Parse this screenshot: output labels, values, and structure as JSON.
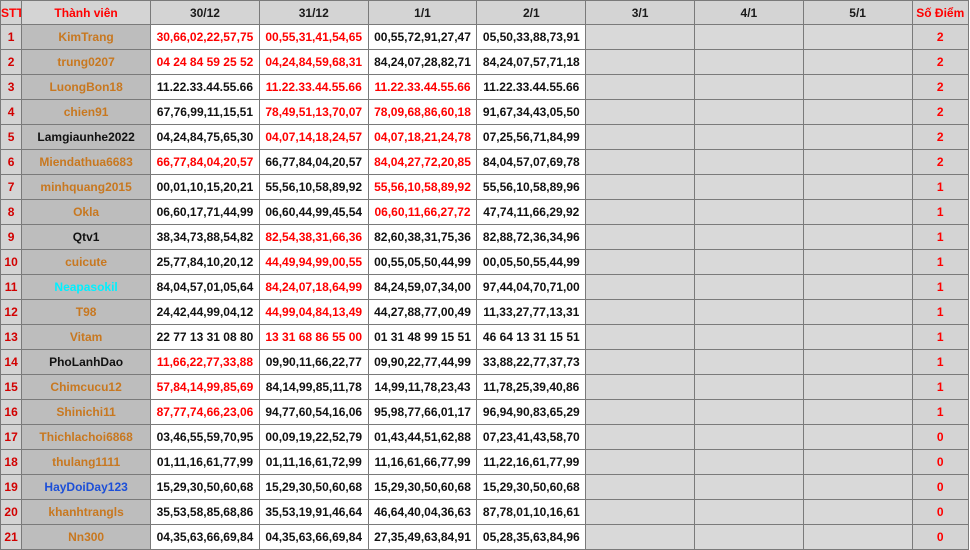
{
  "headers": {
    "stt": "STT",
    "name": "Thành viên",
    "days": [
      "30/12",
      "31/12",
      "1/1",
      "2/1",
      "3/1",
      "4/1",
      "5/1"
    ],
    "score": "Số Điểm"
  },
  "colors": {
    "header_bg": "#d4d4d4",
    "name_bg": "#bdbdbd",
    "empty_bg": "#d9d9d9",
    "hit_red": "#ff0000",
    "name_orange": "#c87820",
    "name_cyan": "#00f0ff",
    "name_blue": "#1c4fd8"
  },
  "rows": [
    {
      "stt": "1",
      "name": "KimTrang",
      "name_color": "orange",
      "cells": [
        {
          "text": "30,66,02,22,57,75",
          "hit": true
        },
        {
          "text": "00,55,31,41,54,65",
          "hit": true
        },
        {
          "text": "00,55,72,91,27,47",
          "hit": false
        },
        {
          "text": "05,50,33,88,73,91",
          "hit": false
        }
      ],
      "score": "2"
    },
    {
      "stt": "2",
      "name": "trung0207",
      "name_color": "orange",
      "cells": [
        {
          "text": "04 24 84 59 25 52",
          "hit": true
        },
        {
          "text": "04,24,84,59,68,31",
          "hit": true
        },
        {
          "text": "84,24,07,28,82,71",
          "hit": false
        },
        {
          "text": "84,24,07,57,71,18",
          "hit": false
        }
      ],
      "score": "2"
    },
    {
      "stt": "3",
      "name": "LuongBon18",
      "name_color": "orange",
      "cells": [
        {
          "text": "11.22.33.44.55.66",
          "hit": false
        },
        {
          "text": "11.22.33.44.55.66",
          "hit": true
        },
        {
          "text": "11.22.33.44.55.66",
          "hit": true
        },
        {
          "text": "11.22.33.44.55.66",
          "hit": false
        }
      ],
      "score": "2"
    },
    {
      "stt": "4",
      "name": "chien91",
      "name_color": "orange",
      "cells": [
        {
          "text": "67,76,99,11,15,51",
          "hit": false
        },
        {
          "text": "78,49,51,13,70,07",
          "hit": true
        },
        {
          "text": "78,09,68,86,60,18",
          "hit": true
        },
        {
          "text": "91,67,34,43,05,50",
          "hit": false
        }
      ],
      "score": "2"
    },
    {
      "stt": "5",
      "name": "Lamgiaunhe2022",
      "name_color": "black",
      "cells": [
        {
          "text": "04,24,84,75,65,30",
          "hit": false
        },
        {
          "text": "04,07,14,18,24,57",
          "hit": true
        },
        {
          "text": "04,07,18,21,24,78",
          "hit": true
        },
        {
          "text": "07,25,56,71,84,99",
          "hit": false
        }
      ],
      "score": "2"
    },
    {
      "stt": "6",
      "name": "Miendathua6683",
      "name_color": "orange",
      "cells": [
        {
          "text": "66,77,84,04,20,57",
          "hit": true
        },
        {
          "text": "66,77,84,04,20,57",
          "hit": false
        },
        {
          "text": "84,04,27,72,20,85",
          "hit": true
        },
        {
          "text": "84,04,57,07,69,78",
          "hit": false
        }
      ],
      "score": "2"
    },
    {
      "stt": "7",
      "name": "minhquang2015",
      "name_color": "orange",
      "cells": [
        {
          "text": "00,01,10,15,20,21",
          "hit": false
        },
        {
          "text": "55,56,10,58,89,92",
          "hit": false
        },
        {
          "text": "55,56,10,58,89,92",
          "hit": true
        },
        {
          "text": "55,56,10,58,89,96",
          "hit": false
        }
      ],
      "score": "1"
    },
    {
      "stt": "8",
      "name": "Okla",
      "name_color": "orange",
      "cells": [
        {
          "text": "06,60,17,71,44,99",
          "hit": false
        },
        {
          "text": "06,60,44,99,45,54",
          "hit": false
        },
        {
          "text": "06,60,11,66,27,72",
          "hit": true
        },
        {
          "text": "47,74,11,66,29,92",
          "hit": false
        }
      ],
      "score": "1"
    },
    {
      "stt": "9",
      "name": "Qtv1",
      "name_color": "black",
      "cells": [
        {
          "text": "38,34,73,88,54,82",
          "hit": false
        },
        {
          "text": "82,54,38,31,66,36",
          "hit": true
        },
        {
          "text": "82,60,38,31,75,36",
          "hit": false
        },
        {
          "text": "82,88,72,36,34,96",
          "hit": false
        }
      ],
      "score": "1"
    },
    {
      "stt": "10",
      "name": "cuicute",
      "name_color": "orange",
      "cells": [
        {
          "text": "25,77,84,10,20,12",
          "hit": false
        },
        {
          "text": "44,49,94,99,00,55",
          "hit": true
        },
        {
          "text": "00,55,05,50,44,99",
          "hit": false
        },
        {
          "text": "00,05,50,55,44,99",
          "hit": false
        }
      ],
      "score": "1"
    },
    {
      "stt": "11",
      "name": "Neapasokil",
      "name_color": "cyan",
      "cells": [
        {
          "text": "84,04,57,01,05,64",
          "hit": false
        },
        {
          "text": "84,24,07,18,64,99",
          "hit": true
        },
        {
          "text": "84,24,59,07,34,00",
          "hit": false
        },
        {
          "text": "97,44,04,70,71,00",
          "hit": false
        }
      ],
      "score": "1"
    },
    {
      "stt": "12",
      "name": "T98",
      "name_color": "orange",
      "cells": [
        {
          "text": "24,42,44,99,04,12",
          "hit": false
        },
        {
          "text": "44,99,04,84,13,49",
          "hit": true
        },
        {
          "text": "44,27,88,77,00,49",
          "hit": false
        },
        {
          "text": "11,33,27,77,13,31",
          "hit": false
        }
      ],
      "score": "1"
    },
    {
      "stt": "13",
      "name": "Vitam",
      "name_color": "orange",
      "cells": [
        {
          "text": "22 77 13 31 08 80",
          "hit": false
        },
        {
          "text": "13 31 68 86 55 00",
          "hit": true
        },
        {
          "text": "01 31 48 99 15 51",
          "hit": false
        },
        {
          "text": "46 64 13 31 15 51",
          "hit": false
        }
      ],
      "score": "1"
    },
    {
      "stt": "14",
      "name": "PhoLanhDao",
      "name_color": "black",
      "cells": [
        {
          "text": "11,66,22,77,33,88",
          "hit": true
        },
        {
          "text": "09,90,11,66,22,77",
          "hit": false
        },
        {
          "text": "09,90,22,77,44,99",
          "hit": false
        },
        {
          "text": "33,88,22,77,37,73",
          "hit": false
        }
      ],
      "score": "1"
    },
    {
      "stt": "15",
      "name": "Chimcucu12",
      "name_color": "orange",
      "cells": [
        {
          "text": "57,84,14,99,85,69",
          "hit": true
        },
        {
          "text": "84,14,99,85,11,78",
          "hit": false
        },
        {
          "text": "14,99,11,78,23,43",
          "hit": false
        },
        {
          "text": "11,78,25,39,40,86",
          "hit": false
        }
      ],
      "score": "1"
    },
    {
      "stt": "16",
      "name": "Shinichi11",
      "name_color": "orange",
      "cells": [
        {
          "text": "87,77,74,66,23,06",
          "hit": true
        },
        {
          "text": "94,77,60,54,16,06",
          "hit": false
        },
        {
          "text": "95,98,77,66,01,17",
          "hit": false
        },
        {
          "text": "96,94,90,83,65,29",
          "hit": false
        }
      ],
      "score": "1"
    },
    {
      "stt": "17",
      "name": "Thichlachoi6868",
      "name_color": "orange",
      "cells": [
        {
          "text": "03,46,55,59,70,95",
          "hit": false
        },
        {
          "text": "00,09,19,22,52,79",
          "hit": false
        },
        {
          "text": "01,43,44,51,62,88",
          "hit": false
        },
        {
          "text": "07,23,41,43,58,70",
          "hit": false
        }
      ],
      "score": "0"
    },
    {
      "stt": "18",
      "name": "thulang1111",
      "name_color": "orange",
      "cells": [
        {
          "text": "01,11,16,61,77,99",
          "hit": false
        },
        {
          "text": "01,11,16,61,72,99",
          "hit": false
        },
        {
          "text": "11,16,61,66,77,99",
          "hit": false
        },
        {
          "text": "11,22,16,61,77,99",
          "hit": false
        }
      ],
      "score": "0"
    },
    {
      "stt": "19",
      "name": "HayDoiDay123",
      "name_color": "blue",
      "cells": [
        {
          "text": "15,29,30,50,60,68",
          "hit": false
        },
        {
          "text": "15,29,30,50,60,68",
          "hit": false
        },
        {
          "text": "15,29,30,50,60,68",
          "hit": false
        },
        {
          "text": "15,29,30,50,60,68",
          "hit": false
        }
      ],
      "score": "0"
    },
    {
      "stt": "20",
      "name": "khanhtrangls",
      "name_color": "orange",
      "cells": [
        {
          "text": "35,53,58,85,68,86",
          "hit": false
        },
        {
          "text": "35,53,19,91,46,64",
          "hit": false
        },
        {
          "text": "46,64,40,04,36,63",
          "hit": false
        },
        {
          "text": "87,78,01,10,16,61",
          "hit": false
        }
      ],
      "score": "0"
    },
    {
      "stt": "21",
      "name": "Nn300",
      "name_color": "orange",
      "cells": [
        {
          "text": "04,35,63,66,69,84",
          "hit": false
        },
        {
          "text": "04,35,63,66,69,84",
          "hit": false
        },
        {
          "text": "27,35,49,63,84,91",
          "hit": false
        },
        {
          "text": "05,28,35,63,84,96",
          "hit": false
        }
      ],
      "score": "0"
    }
  ]
}
